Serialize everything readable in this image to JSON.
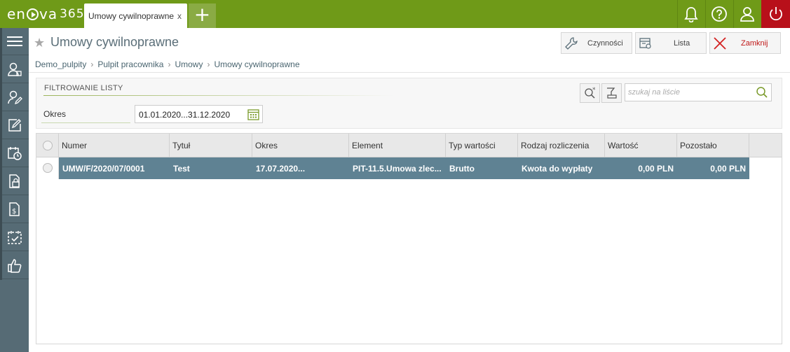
{
  "app": {
    "logo_text": "en",
    "logo_after": "va",
    "logo_suffix": "365"
  },
  "tabs": [
    {
      "label": "Umowy cywilnoprawne",
      "close": "x"
    }
  ],
  "new_tab_label": "+",
  "toolbar_icons": [
    "bell-icon",
    "help-icon",
    "user-icon",
    "power-icon"
  ],
  "sidebar_icons": [
    "menu-icon",
    "employee-icon",
    "employee-edit-icon",
    "edit-icon",
    "calendar-clock-icon",
    "document-lock-icon",
    "document-money-icon",
    "calendar-check-icon",
    "thumbs-up-icon"
  ],
  "page": {
    "title": "Umowy cywilnoprawne"
  },
  "actions": {
    "czynnosci": "Czynności",
    "lista": "Lista",
    "zamknij": "Zamknij"
  },
  "breadcrumb": [
    "Demo_pulpity",
    "Pulpit pracownika",
    "Umowy",
    "Umowy cywilnoprawne"
  ],
  "filter": {
    "title": "FILTROWANIE LISTY",
    "okres_label": "Okres",
    "okres_value": "01.01.2020...31.12.2020",
    "search_placeholder": "szukaj na liście"
  },
  "table": {
    "columns": [
      "Numer",
      "Tytuł",
      "Okres",
      "Element",
      "Typ wartości",
      "Rodzaj rozliczenia",
      "Wartość",
      "Pozostało"
    ],
    "rows": [
      [
        "UMW/F/2020/07/0001",
        "Test",
        "17.07.2020...",
        "PIT-11.5.Umowa zlec...",
        "Brutto",
        "Kwota do wypłaty",
        "0,00 PLN",
        "0,00 PLN"
      ]
    ]
  },
  "colors": {
    "topbar": "#6f9a18",
    "sidebar": "#566b75",
    "selected_row": "#5f8293",
    "power": "#b8101a",
    "close_x": "#d32020"
  }
}
